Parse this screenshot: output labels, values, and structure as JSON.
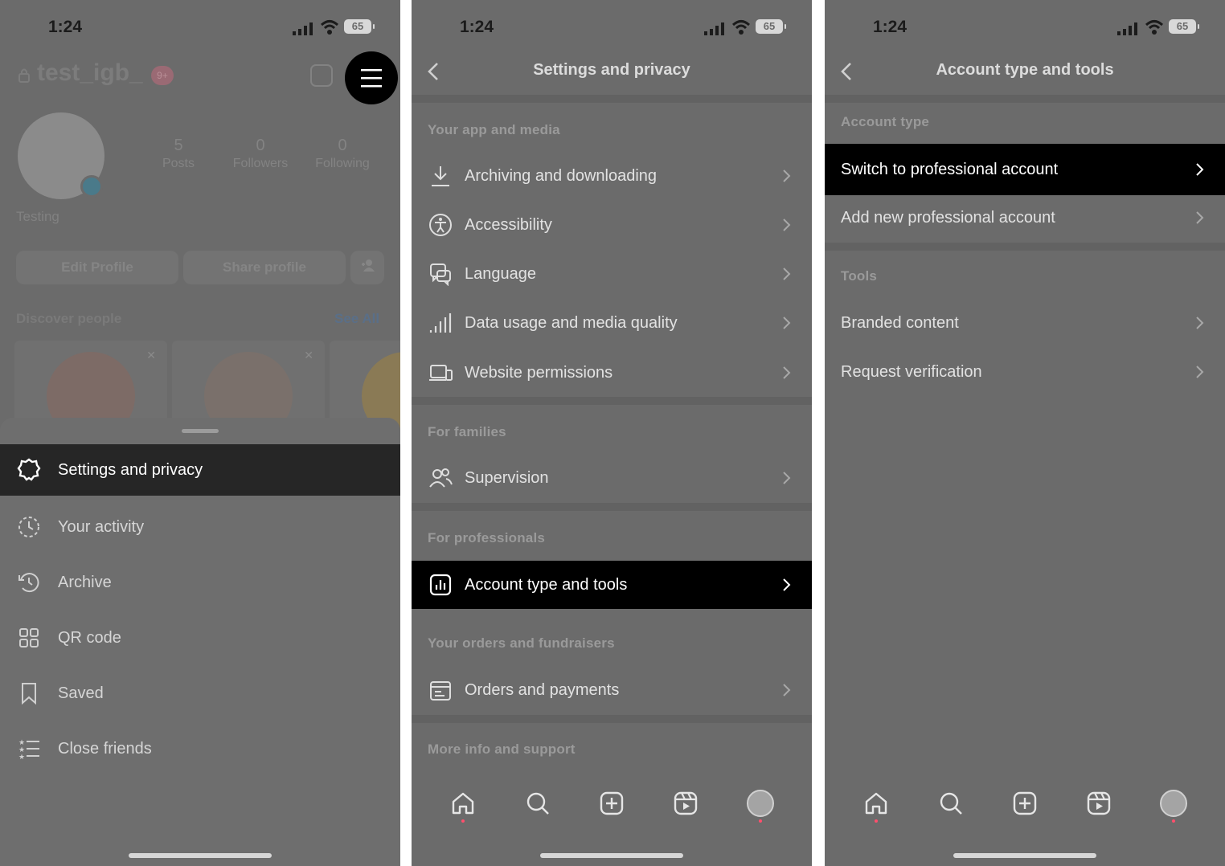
{
  "colors": {
    "background_dim": "#6b6b6b",
    "highlight": "#000000",
    "sheet_highlight": "#262626",
    "notification_dot": "#ff4f6d"
  },
  "status": {
    "time": "1:24",
    "battery": "65"
  },
  "panel1": {
    "username": "test_igb_",
    "badge": "9+",
    "stats": [
      {
        "num": "5",
        "label": "Posts"
      },
      {
        "num": "0",
        "label": "Followers"
      },
      {
        "num": "0",
        "label": "Following"
      }
    ],
    "display_name": "Testing",
    "edit_profile": "Edit Profile",
    "share_profile": "Share profile",
    "discover_people": "Discover people",
    "see_all": "See All",
    "menu_items": [
      {
        "label": "Settings and privacy",
        "icon": "gear-icon"
      },
      {
        "label": "Your activity",
        "icon": "activity-icon"
      },
      {
        "label": "Archive",
        "icon": "archive-icon"
      },
      {
        "label": "QR code",
        "icon": "qr-code-icon"
      },
      {
        "label": "Saved",
        "icon": "bookmark-icon"
      },
      {
        "label": "Close friends",
        "icon": "close-friends-icon"
      }
    ]
  },
  "panel2": {
    "title": "Settings and privacy",
    "sections": {
      "app_media": "Your app and media",
      "families": "For families",
      "professionals": "For professionals",
      "orders": "Your orders and fundraisers",
      "more": "More info and support"
    },
    "items": {
      "archiving": "Archiving and downloading",
      "accessibility": "Accessibility",
      "language": "Language",
      "data_usage": "Data usage and media quality",
      "website": "Website permissions",
      "supervision": "Supervision",
      "account_type": "Account type and tools",
      "orders": "Orders and payments"
    }
  },
  "panel3": {
    "title": "Account type and tools",
    "sections": {
      "account_type": "Account type",
      "tools": "Tools"
    },
    "items": {
      "switch": "Switch to professional account",
      "add_new": "Add new professional account",
      "branded": "Branded content",
      "verification": "Request verification"
    }
  }
}
